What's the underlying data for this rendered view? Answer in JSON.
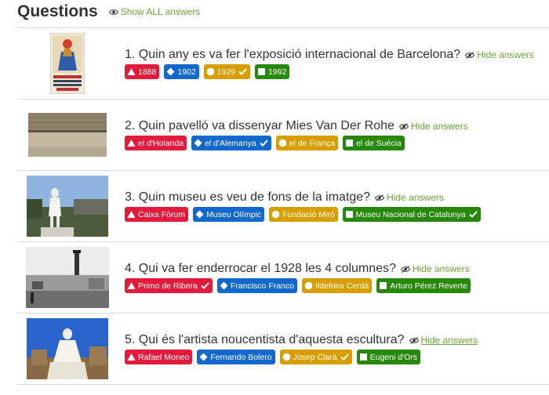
{
  "header": {
    "title": "Questions",
    "show_all_label": "Show ALL answers"
  },
  "questions": [
    {
      "text": "1. Quin any es va fer l'exposició internacional de Barcelona?",
      "hide_label": "Hide answers",
      "image": "exposition-poster",
      "answers": [
        {
          "label": "1888",
          "shape": "triangle",
          "color": "red",
          "correct": false
        },
        {
          "label": "1902",
          "shape": "diamond",
          "color": "blue",
          "correct": false
        },
        {
          "label": "1929",
          "shape": "circle",
          "color": "gold",
          "correct": true
        },
        {
          "label": "1992",
          "shape": "square",
          "color": "green",
          "correct": false
        }
      ]
    },
    {
      "text": "2. Quin pavelló va dissenyar Mies Van Der Rohe",
      "hide_label": "Hide answers",
      "image": "pavilion-photo",
      "answers": [
        {
          "label": "el d'Holanda",
          "shape": "triangle",
          "color": "red",
          "correct": false
        },
        {
          "label": "el d'Alemanya",
          "shape": "diamond",
          "color": "blue",
          "correct": true
        },
        {
          "label": "el de França",
          "shape": "circle",
          "color": "gold",
          "correct": false
        },
        {
          "label": "el de Suècia",
          "shape": "square",
          "color": "green",
          "correct": false
        }
      ]
    },
    {
      "text": "3. Quin museu es veu de fons de la imatge?",
      "hide_label": "Hide answers",
      "image": "statue-photo",
      "answers": [
        {
          "label": "Caixa Fòrum",
          "shape": "triangle",
          "color": "red",
          "correct": false
        },
        {
          "label": "Museu Olímpic",
          "shape": "diamond",
          "color": "blue",
          "correct": false
        },
        {
          "label": "Fundació Miró",
          "shape": "circle",
          "color": "gold",
          "correct": false
        },
        {
          "label": "Museu Nacional de Catalunya",
          "shape": "square",
          "color": "green",
          "correct": true
        }
      ]
    },
    {
      "text": "4. Qui va fer enderrocar el 1928 les 4 columnes?",
      "hide_label": "Hide answers",
      "image": "columns-photo",
      "answers": [
        {
          "label": "Primo de Ribera",
          "shape": "triangle",
          "color": "red",
          "correct": true
        },
        {
          "label": "Francisco Franco",
          "shape": "diamond",
          "color": "blue",
          "correct": false
        },
        {
          "label": "Ildefons Cerdà",
          "shape": "circle",
          "color": "gold",
          "correct": false
        },
        {
          "label": "Arturo Pérez Reverte",
          "shape": "square",
          "color": "green",
          "correct": false
        }
      ]
    },
    {
      "text": "5. Qui és l'artista noucentista d'aquesta escultura?",
      "hide_label": "Hide answers",
      "image": "sculpture-photo",
      "answers": [
        {
          "label": "Rafael Moneo",
          "shape": "triangle",
          "color": "red",
          "correct": false
        },
        {
          "label": "Fernando Bolero",
          "shape": "diamond",
          "color": "blue",
          "correct": false
        },
        {
          "label": "Josep Clarà",
          "shape": "circle",
          "color": "gold",
          "correct": true
        },
        {
          "label": "Eugeni d'Ors",
          "shape": "square",
          "color": "green",
          "correct": false
        }
      ]
    }
  ],
  "colors": {
    "red": "#e21b3c",
    "blue": "#1368ce",
    "gold": "#d89e00",
    "green": "#26890c",
    "link": "#6aa533"
  }
}
